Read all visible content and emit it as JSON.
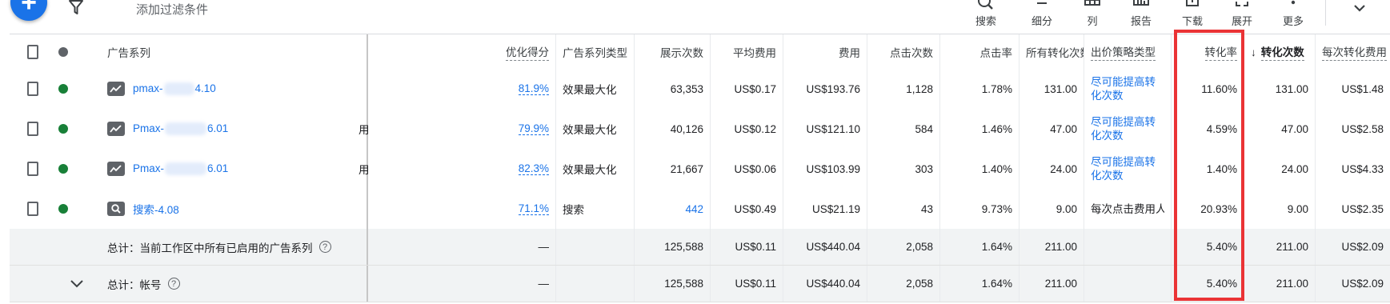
{
  "toolbar": {
    "add_icon": "plus-icon",
    "filter_placeholder": "添加过滤条件",
    "tools": [
      {
        "label": "搜索",
        "icon": "search-icon"
      },
      {
        "label": "细分",
        "icon": "segment-icon"
      },
      {
        "label": "列",
        "icon": "columns-icon"
      },
      {
        "label": "报告",
        "icon": "report-icon"
      },
      {
        "label": "下载",
        "icon": "download-icon"
      },
      {
        "label": "展开",
        "icon": "expand-icon"
      },
      {
        "label": "更多",
        "icon": "more-icon"
      }
    ]
  },
  "table": {
    "headers": {
      "campaign": "广告系列",
      "score": "优化得分",
      "type": "广告系列类型",
      "impressions": "展示次数",
      "avg_cost": "平均费用",
      "cost": "费用",
      "clicks": "点击次数",
      "ctr": "点击率",
      "all_conv": "所有转化次数",
      "bidding": "出价策略类型",
      "conv_rate": "转化率",
      "sort_arrow": "↓",
      "conversions": "转化次数",
      "cost_per_conv": "每次转化费用"
    },
    "rows": [
      {
        "name_prefix": "pmax-",
        "name_suffix": "4.10",
        "icon": "trend-icon",
        "status_color": "#188038",
        "edge_glyph": "",
        "score": "81.9%",
        "type": "效果最大化",
        "impressions": "63,353",
        "avg_cost": "US$0.17",
        "cost": "US$193.76",
        "clicks": "1,128",
        "ctr": "1.78%",
        "all_conv": "131.00",
        "bidding": "尽可能提高转化次数",
        "bidding_link": true,
        "conv_rate": "11.60%",
        "conversions": "131.00",
        "cost_per_conv": "US$1.48"
      },
      {
        "name_prefix": "Pmax-",
        "name_suffix": "6.01",
        "icon": "trend-icon",
        "status_color": "#188038",
        "edge_glyph": "用",
        "score": "79.9%",
        "type": "效果最大化",
        "impressions": "40,126",
        "avg_cost": "US$0.12",
        "cost": "US$121.10",
        "clicks": "584",
        "ctr": "1.46%",
        "all_conv": "47.00",
        "bidding": "尽可能提高转化次数",
        "bidding_link": true,
        "conv_rate": "4.59%",
        "conversions": "47.00",
        "cost_per_conv": "US$2.58"
      },
      {
        "name_prefix": "Pmax-",
        "name_suffix": "6.01",
        "icon": "trend-icon",
        "status_color": "#188038",
        "edge_glyph": "用",
        "score": "82.3%",
        "type": "效果最大化",
        "impressions": "21,667",
        "avg_cost": "US$0.06",
        "cost": "US$103.99",
        "clicks": "303",
        "ctr": "1.40%",
        "all_conv": "24.00",
        "bidding": "尽可能提高转化次数",
        "bidding_link": true,
        "conv_rate": "1.40%",
        "conversions": "24.00",
        "cost_per_conv": "US$4.33"
      },
      {
        "name_prefix": "搜索-4.08",
        "name_suffix": "",
        "icon": "search-icon",
        "status_color": "#188038",
        "edge_glyph": "",
        "score": "71.1%",
        "type": "搜索",
        "impressions": "442",
        "avg_cost": "US$0.49",
        "cost": "US$21.19",
        "clicks": "43",
        "ctr": "9.73%",
        "all_conv": "9.00",
        "bidding": "每次点击费用人工",
        "bidding_link": false,
        "conv_rate": "20.93%",
        "conversions": "9.00",
        "cost_per_conv": "US$2.35"
      }
    ],
    "totals": [
      {
        "label": "总计：当前工作区中所有已启用的广告系列",
        "score": "—",
        "impressions": "125,588",
        "avg_cost": "US$0.11",
        "cost": "US$440.04",
        "clicks": "2,058",
        "ctr": "1.64%",
        "all_conv": "211.00",
        "conv_rate": "5.40%",
        "conversions": "211.00",
        "cost_per_conv": "US$2.09"
      },
      {
        "label": "总计：帐号",
        "score": "—",
        "impressions": "125,588",
        "avg_cost": "US$0.11",
        "cost": "US$440.04",
        "clicks": "2,058",
        "ctr": "1.64%",
        "all_conv": "211.00",
        "conv_rate": "5.40%",
        "conversions": "211.00",
        "cost_per_conv": "US$2.09"
      }
    ]
  },
  "colors": {
    "highlight": "#ea3335",
    "link": "#1a73e8",
    "enabled": "#188038"
  }
}
